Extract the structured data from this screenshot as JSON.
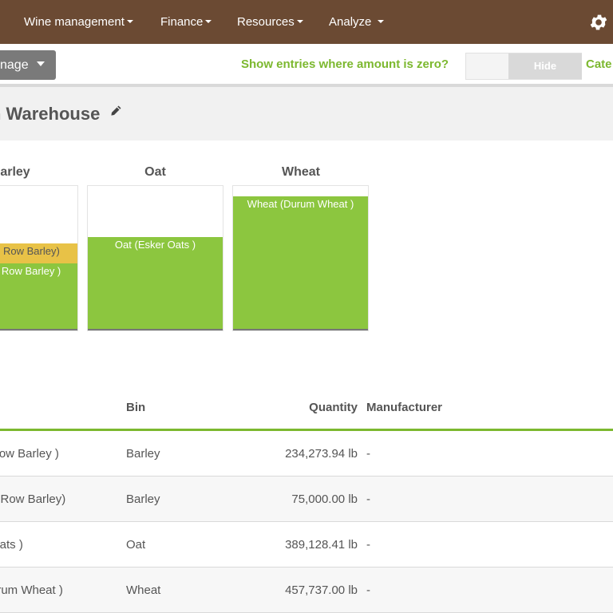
{
  "nav": {
    "items": [
      "Wine management",
      "Finance",
      "Resources",
      "Analyze"
    ],
    "icon": "gear-icon"
  },
  "toolbar": {
    "manage_label": "nage",
    "zero_label": "Show entries where amount is zero?",
    "toggle_label": "Hide",
    "category_label": "Cate"
  },
  "page": {
    "title": "n Warehouse"
  },
  "bins": [
    {
      "name": "arley",
      "segments": [
        {
          "label": "o Row Barley)",
          "color": "#e8c247",
          "fraction": 0.14
        },
        {
          "label": "x Row Barley )",
          "color": "#8cc63f",
          "fraction": 0.46
        }
      ]
    },
    {
      "name": "Oat",
      "segments": [
        {
          "label": "Oat (Esker Oats )",
          "color": "#8cc63f",
          "fraction": 0.64
        }
      ]
    },
    {
      "name": "Wheat",
      "segments": [
        {
          "label": "Wheat (Durum Wheat )",
          "color": "#8cc63f",
          "fraction": 0.93
        }
      ]
    }
  ],
  "table": {
    "headers": {
      "bin": "Bin",
      "quantity": "Quantity",
      "manufacturer": "Manufacturer"
    },
    "rows": [
      {
        "name": "Row Barley )",
        "bin": "Barley",
        "quantity": "234,273.94 lb",
        "manufacturer": "-"
      },
      {
        "name": "o Row Barley)",
        "bin": "Barley",
        "quantity": "75,000.00 lb",
        "manufacturer": "-"
      },
      {
        "name": "Oats )",
        "bin": "Oat",
        "quantity": "389,128.41 lb",
        "manufacturer": "-"
      },
      {
        "name": "urum Wheat )",
        "bin": "Wheat",
        "quantity": "457,737.00 lb",
        "manufacturer": "-"
      }
    ]
  }
}
